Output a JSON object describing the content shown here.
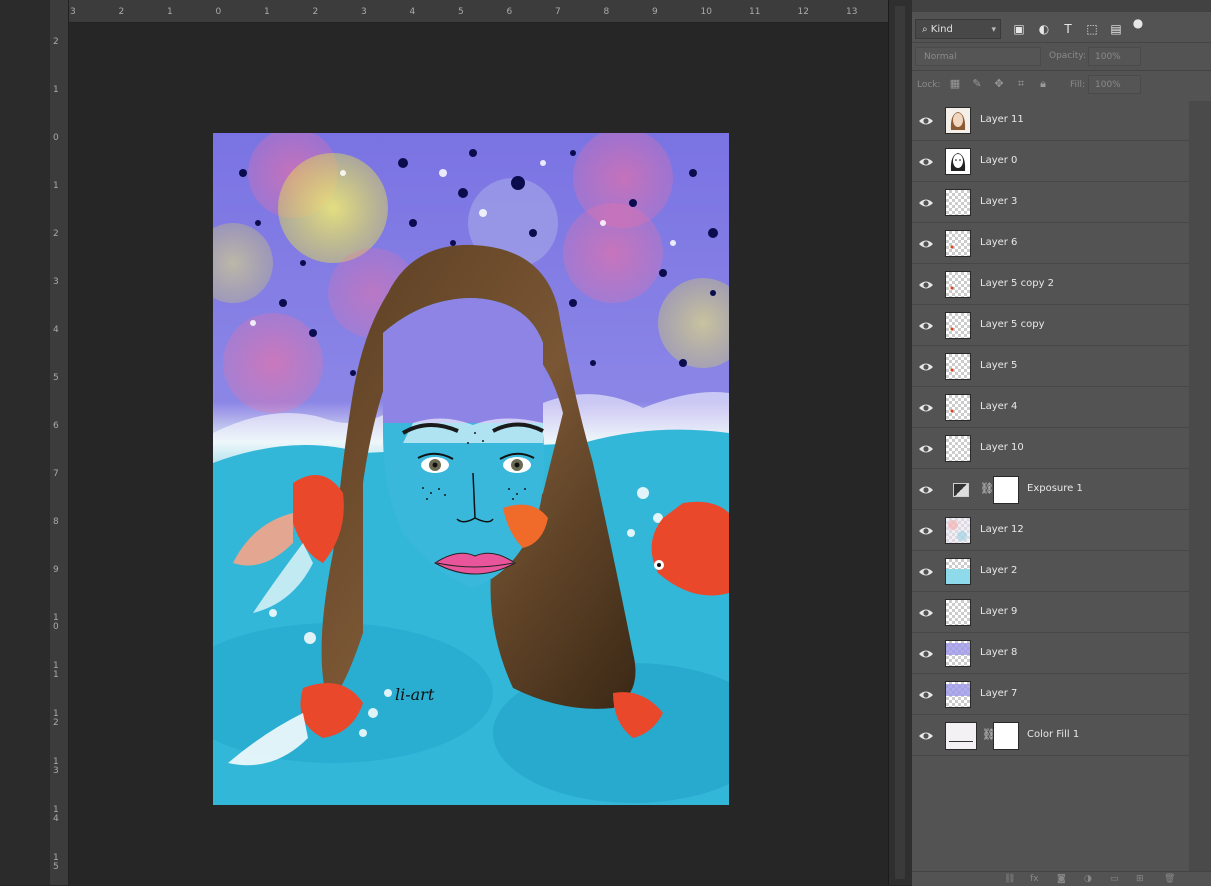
{
  "rulers": {
    "horizontal": [
      "3",
      "2",
      "1",
      "0",
      "1",
      "2",
      "3",
      "4",
      "5",
      "6",
      "7",
      "8",
      "9",
      "10",
      "11",
      "12",
      "13"
    ],
    "vertical": [
      "2",
      "1",
      "0",
      "1",
      "2",
      "3",
      "4",
      "5",
      "6",
      "7",
      "8",
      "9",
      "10",
      "11",
      "12",
      "13",
      "14",
      "15"
    ]
  },
  "artwork": {
    "signature": "li-art"
  },
  "layers_panel": {
    "filter": {
      "kind_label": "Kind"
    },
    "blend_mode": "Normal",
    "opacity_label": "Opacity:",
    "opacity_value": "100%",
    "lock_label": "Lock:",
    "fill_label": "Fill:",
    "fill_value": "100%",
    "layers": [
      {
        "name": "Layer 11",
        "kind": "face-sketch"
      },
      {
        "name": "Layer 0",
        "kind": "face-lineart"
      },
      {
        "name": "Layer 3",
        "kind": "transparent"
      },
      {
        "name": "Layer 6",
        "kind": "small-red"
      },
      {
        "name": "Layer 5 copy 2",
        "kind": "small-red"
      },
      {
        "name": "Layer 5 copy",
        "kind": "small-red"
      },
      {
        "name": "Layer 5",
        "kind": "small-red"
      },
      {
        "name": "Layer 4",
        "kind": "small-red"
      },
      {
        "name": "Layer 10",
        "kind": "transparent"
      },
      {
        "name": "Exposure 1",
        "kind": "adjustment"
      },
      {
        "name": "Layer 12",
        "kind": "pastel"
      },
      {
        "name": "Layer 2",
        "kind": "cyan"
      },
      {
        "name": "Layer 9",
        "kind": "transparent"
      },
      {
        "name": "Layer 8",
        "kind": "violet"
      },
      {
        "name": "Layer 7",
        "kind": "violet"
      },
      {
        "name": "Color Fill 1",
        "kind": "colorfill"
      }
    ]
  },
  "colors": {
    "canvas_bg": "#262626",
    "panel_bg": "#535353",
    "accent": "#3b8ede"
  }
}
